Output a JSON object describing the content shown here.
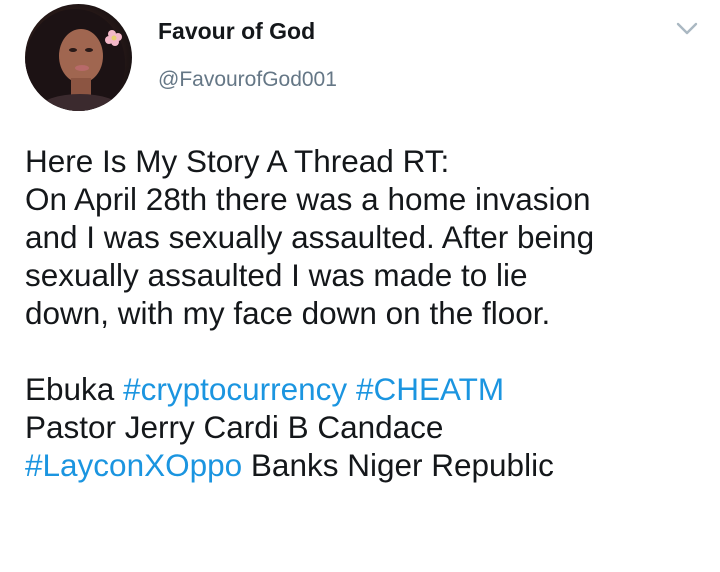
{
  "tweet": {
    "display_name": "Favour of God",
    "handle": "@FavourofGod001",
    "lines": [
      "Here Is My Story A Thread RT:",
      "On April 28th there was a home invasion",
      "and I was sexually assaulted. After being",
      "sexually assaulted I was made to lie",
      "down, with my face down on the floor."
    ],
    "tags_line1": {
      "text1": "Ebuka ",
      "tag1": "#cryptocurrency",
      "space": " ",
      "tag2": "#CHEATM"
    },
    "tags_line2": "Pastor Jerry Cardi B Candace",
    "tags_line3": {
      "tag": "#LayconXOppo",
      "text": " Banks Niger Republic"
    }
  },
  "icons": {
    "menu": "chevron-down-icon",
    "avatar": "profile-photo"
  },
  "colors": {
    "text": "#14171a",
    "handle": "#657786",
    "link": "#1b95e0",
    "chevron": "#aab8c2"
  }
}
